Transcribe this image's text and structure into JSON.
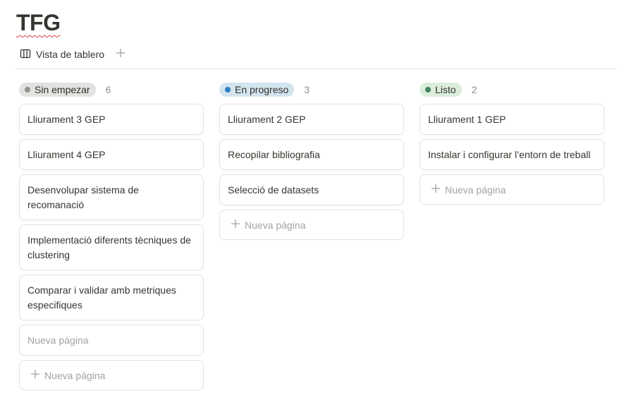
{
  "page": {
    "title": "TFG"
  },
  "view": {
    "tab_label": "Vista de tablero"
  },
  "board": {
    "columns": [
      {
        "status": "Sin empezar",
        "count": "6",
        "pill_bg": "#e3e2e0",
        "dot_color": "#91918e",
        "cards": [
          "Lliurament 3 GEP",
          "Lliurament 4 GEP",
          "Desenvolupar sistema de recomanació",
          "Implementació diferents tècniques de clustering",
          "Comparar i validar amb metriques especifiques",
          "Nueva página"
        ],
        "new_page_label": "Nueva página"
      },
      {
        "status": "En progreso",
        "count": "3",
        "pill_bg": "#d3e5ef",
        "dot_color": "#2e7fc1",
        "cards": [
          "Lliurament 2 GEP",
          "Recopilar bibliografia",
          "Selecció de datasets"
        ],
        "new_page_label": "Nueva página"
      },
      {
        "status": "Listo",
        "count": "2",
        "pill_bg": "#dbeddb",
        "dot_color": "#448361",
        "cards": [
          "Lliurament 1 GEP",
          "Instalar i configurar l’entorn de treball"
        ],
        "new_page_label": "Nueva página"
      }
    ]
  }
}
